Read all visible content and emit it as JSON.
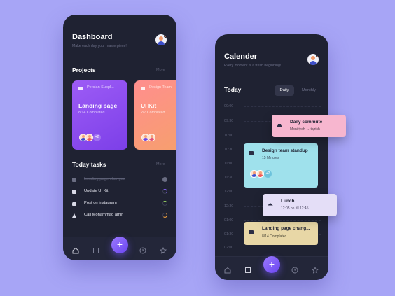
{
  "colors": {
    "background": "#a7a5f6",
    "phone": "#1f2232",
    "accent": "#7b57ff"
  },
  "dashboard": {
    "title": "Dashboard",
    "subtitle": "Make each day your masterpiece!",
    "projects_title": "Projects",
    "more": "More",
    "projects": [
      {
        "tag": "Persian Suppl...",
        "title": "Landing page",
        "subtitle": "8/14 Complated",
        "extra": "+2"
      },
      {
        "tag": "Design Team",
        "title": "UI Kit",
        "subtitle": "2/7 Complated"
      }
    ],
    "tasks_title": "Today tasks",
    "tasks_more": "More",
    "tasks": [
      {
        "label": "Landing page changes",
        "done": true,
        "progress": 1.0
      },
      {
        "label": "Update UI Kit",
        "done": false,
        "progress": 0.6
      },
      {
        "label": "Post on instagram",
        "done": false,
        "progress": 0.3
      },
      {
        "label": "Call Mohammad amin",
        "done": false,
        "progress": 0.4
      }
    ]
  },
  "calendar": {
    "title": "Calender",
    "subtitle": "Every moment is a fresh beginning!",
    "today": "Today",
    "view_daily": "Daily",
    "view_monthly": "Monthly",
    "times": [
      "09:00",
      "09:30",
      "10:00",
      "10:30",
      "11:00",
      "11:30",
      "12:00",
      "12:30",
      "01:00",
      "01:30",
      "02:00"
    ],
    "events": [
      {
        "title": "Daily commute",
        "sub": "Moniriyeh  →  tajrish"
      },
      {
        "title": "Design team standup",
        "sub": "15 Minutes",
        "extra": "+2"
      },
      {
        "title": "Lunch",
        "sub": "12:05 on till 12:45"
      },
      {
        "title": "Landing page chang...",
        "sub": "8/14 Complated"
      }
    ]
  },
  "tabbar": {
    "fab_label": "+",
    "icons": [
      "home-icon",
      "grid-icon",
      "add-icon",
      "clock-icon",
      "star-icon"
    ]
  }
}
